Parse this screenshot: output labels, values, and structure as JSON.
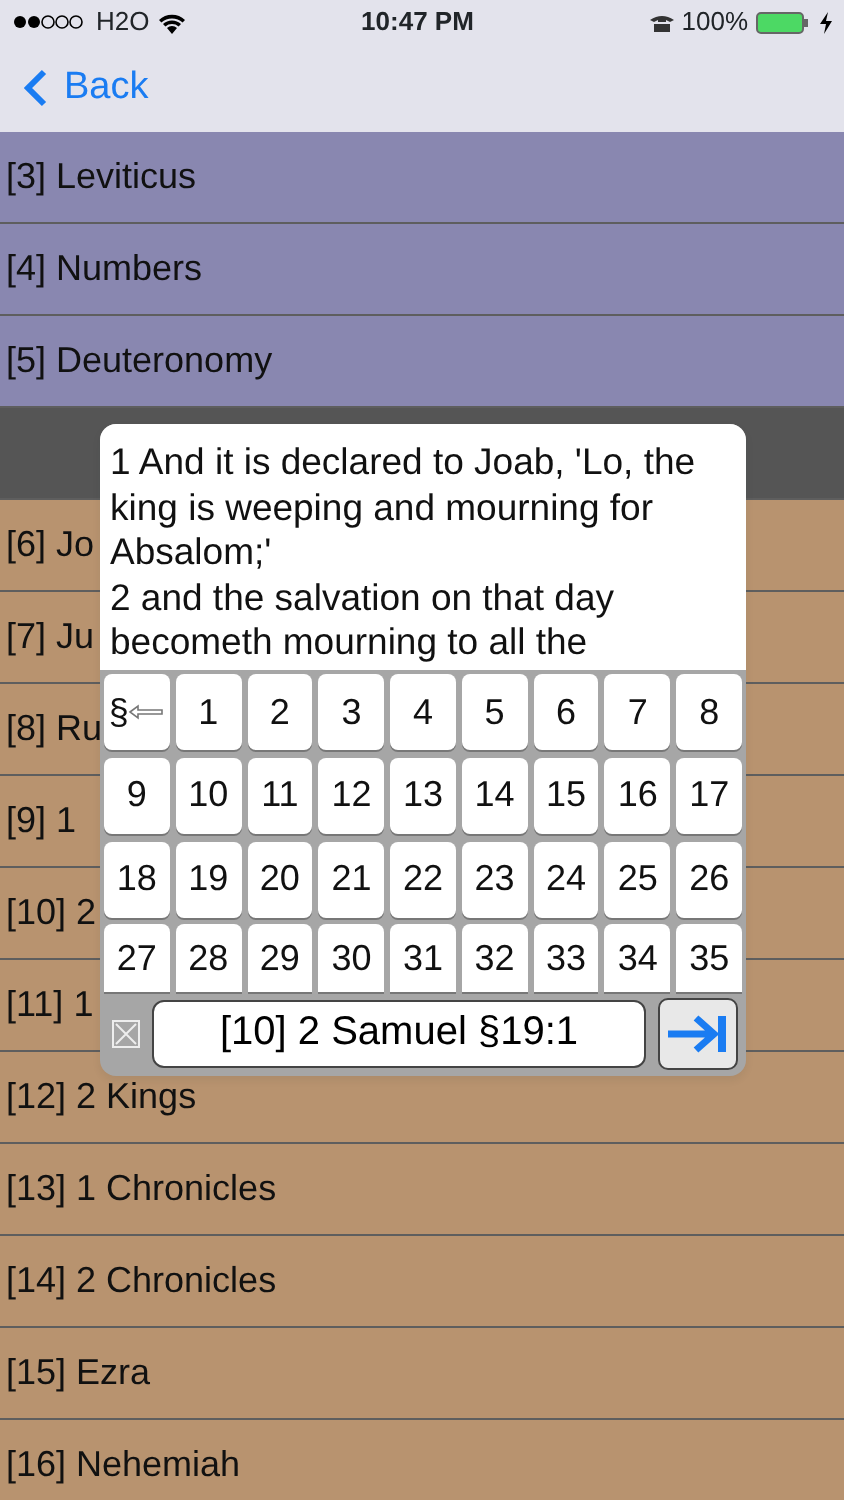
{
  "status_bar": {
    "carrier": "H2O",
    "time": "10:47 PM",
    "battery": "100%"
  },
  "nav": {
    "back": "Back"
  },
  "books": [
    {
      "label": "[3] Leviticus",
      "kind": "old"
    },
    {
      "label": "[4] Numbers",
      "kind": "old"
    },
    {
      "label": "[5] Deuteronomy",
      "kind": "old"
    },
    {
      "kind": "header"
    },
    {
      "label": "[6] Jo",
      "kind": "history"
    },
    {
      "label": "[7] Ju",
      "kind": "history"
    },
    {
      "label": "[8] Ru",
      "kind": "history"
    },
    {
      "label": "[9] 1",
      "kind": "history"
    },
    {
      "label": "[10] 2",
      "kind": "history"
    },
    {
      "label": "[11] 1",
      "kind": "history"
    },
    {
      "label": "[12] 2 Kings",
      "kind": "history"
    },
    {
      "label": "[13] 1 Chronicles",
      "kind": "history"
    },
    {
      "label": "[14] 2 Chronicles",
      "kind": "history"
    },
    {
      "label": "[15] Ezra",
      "kind": "history"
    },
    {
      "label": "[16] Nehemiah",
      "kind": "history"
    }
  ],
  "popup": {
    "verses": [
      "1 And it is declared to Joab, 'Lo, the king is weeping and mourning for Absalom;'",
      "2 and the salvation on that day becometh mourning to all the"
    ],
    "back_key": "§",
    "keys": [
      "1",
      "2",
      "3",
      "4",
      "5",
      "6",
      "7",
      "8",
      "9",
      "10",
      "11",
      "12",
      "13",
      "14",
      "15",
      "16",
      "17",
      "18",
      "19",
      "20",
      "21",
      "22",
      "23",
      "24",
      "25",
      "26",
      "27",
      "28",
      "29",
      "30",
      "31",
      "32",
      "33",
      "34",
      "35"
    ],
    "reference": "[10] 2 Samuel §19:1"
  }
}
